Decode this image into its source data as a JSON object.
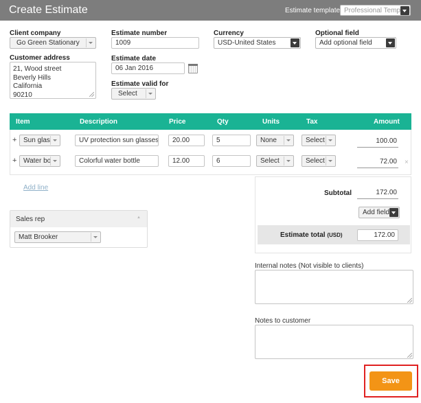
{
  "header": {
    "title": "Create Estimate",
    "template_label": "Estimate template",
    "template_value": "Professional Template"
  },
  "client": {
    "label": "Client company",
    "value": "Go Green Stationary"
  },
  "address": {
    "label": "Customer address",
    "lines": [
      "21, Wood street",
      "Beverly Hills",
      "California",
      "90210"
    ]
  },
  "estimate_number": {
    "label": "Estimate number",
    "value": "1009"
  },
  "estimate_date": {
    "label": "Estimate date",
    "value": "06 Jan 2016"
  },
  "valid_for": {
    "label": "Estimate valid for",
    "value": "Select"
  },
  "currency": {
    "label": "Currency",
    "value": "USD-United States"
  },
  "optional_field": {
    "label": "Optional field",
    "value": "Add optional field"
  },
  "table": {
    "headers": [
      "Item",
      "Description",
      "Price",
      "Qty",
      "Units",
      "Tax",
      "Amount"
    ],
    "rows": [
      {
        "plus": "+",
        "item": "Sun glass",
        "description": "UV protection sun glasses",
        "price": "20.00",
        "qty": "5",
        "units": "None",
        "tax": "Select",
        "amount": "100.00"
      },
      {
        "plus": "+",
        "item": "Water bot",
        "description": "Colorful water bottle",
        "price": "12.00",
        "qty": "6",
        "units": "Select",
        "tax": "Select",
        "amount": "72.00"
      }
    ],
    "remove_glyph": "×"
  },
  "add_line": "Add line",
  "summary": {
    "subtotal_label": "Subtotal",
    "subtotal_value": "172.00",
    "add_field": "Add field",
    "total_label": "Estimate total",
    "total_currency": "(USD)",
    "total_value": "172.00"
  },
  "sales_rep": {
    "label": "Sales rep",
    "value": "Matt Brooker",
    "collapse_glyph": "▲"
  },
  "internal_notes": {
    "label": "Internal notes (Not visible to clients)",
    "value": ""
  },
  "customer_notes": {
    "label": "Notes to customer",
    "value": ""
  },
  "save_label": "Save",
  "colors": {
    "header_bg": "#7d7d7d",
    "table_header_bg": "#1ab394",
    "save_bg": "#f39416",
    "highlight_frame": "#e02020"
  }
}
